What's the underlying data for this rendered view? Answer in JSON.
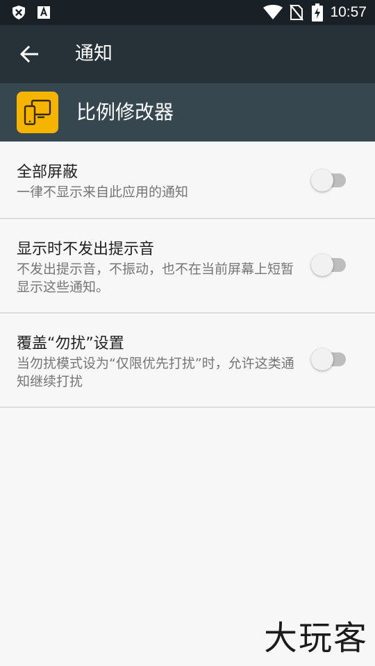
{
  "status_bar": {
    "time": "10:57",
    "left_icons": [
      "shield-x-icon",
      "text-a-icon"
    ],
    "right_icons": [
      "wifi-icon",
      "no-sim-icon",
      "battery-charging-icon"
    ]
  },
  "toolbar": {
    "back_icon": "arrow-left-icon",
    "title": "通知"
  },
  "app": {
    "name": "比例修改器",
    "icon": "devices-icon",
    "icon_color": "#f5b400"
  },
  "settings": [
    {
      "title": "全部屏蔽",
      "subtitle": "一律不显示来自此应用的通知",
      "enabled": false
    },
    {
      "title": "显示时不发出提示音",
      "subtitle": "不发出提示音，不振动，也不在当前屏幕上短暂显示这些通知。",
      "enabled": false
    },
    {
      "title": "覆盖“勿扰”设置",
      "subtitle": "当勿扰模式设为“仅限优先打扰”时，允许这类通知继续打扰",
      "enabled": false
    }
  ],
  "watermark": "大玩客",
  "colors": {
    "status_bar": "#1a2126",
    "toolbar": "#263238",
    "app_header": "#37474f",
    "background": "#f7f7f7"
  }
}
